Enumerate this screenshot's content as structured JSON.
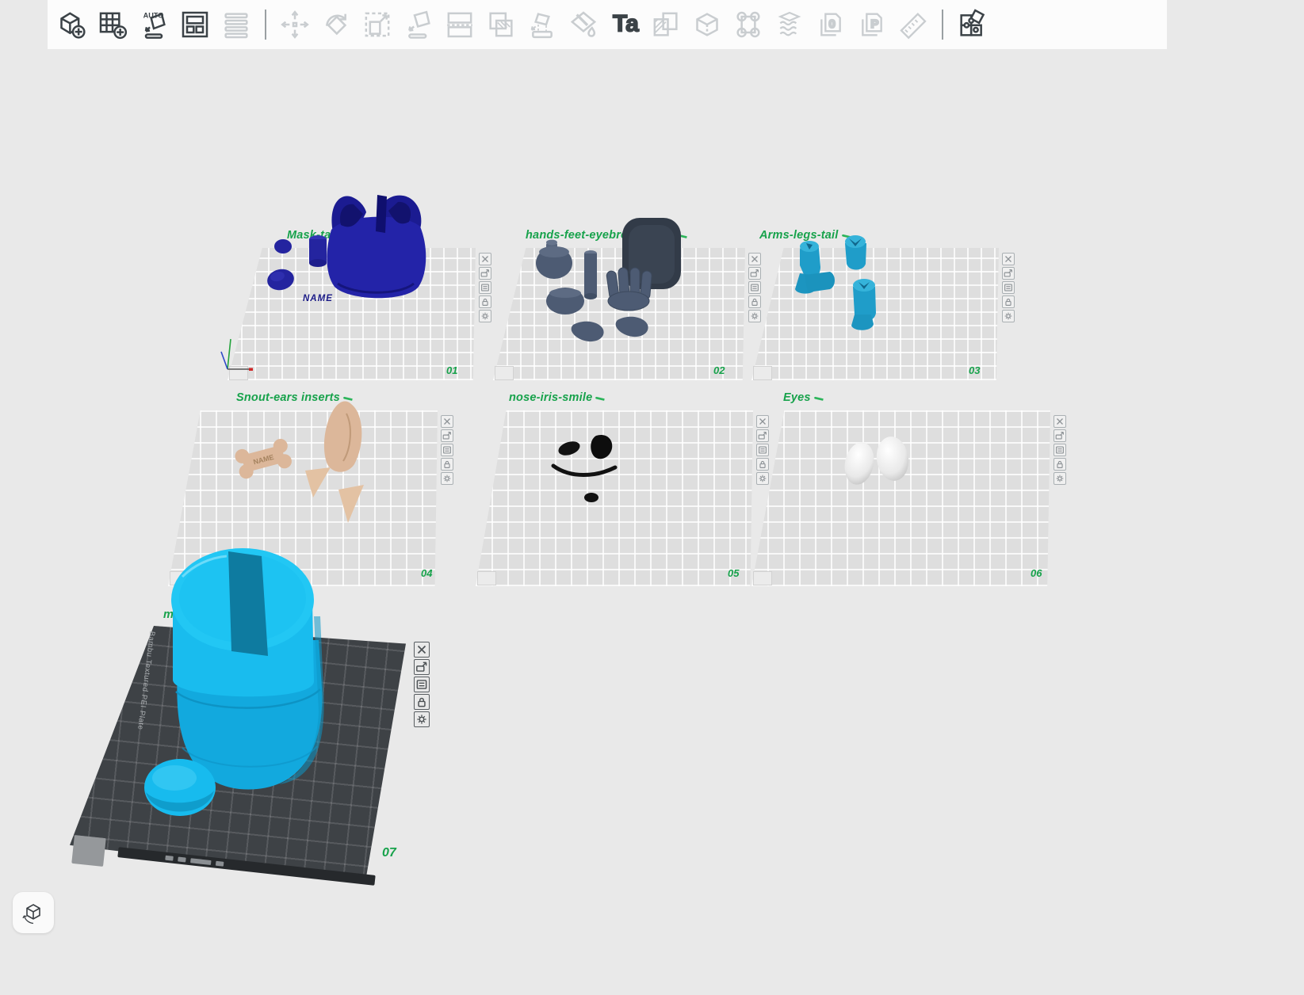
{
  "toolbar": {
    "auto_label": "AUTO",
    "text_tool_label": "Ta",
    "doc_zero_label": "0",
    "doc_p_label": "P",
    "tools": [
      {
        "name": "add-object",
        "enabled": true
      },
      {
        "name": "add-plate",
        "enabled": true
      },
      {
        "name": "auto-orient",
        "enabled": true
      },
      {
        "name": "arrange-all",
        "enabled": true
      },
      {
        "name": "variable-layer-height",
        "enabled": false
      },
      {
        "name": "move",
        "enabled": false
      },
      {
        "name": "rotate",
        "enabled": false
      },
      {
        "name": "scale",
        "enabled": false
      },
      {
        "name": "place-on-face",
        "enabled": false
      },
      {
        "name": "cut",
        "enabled": false
      },
      {
        "name": "mesh-boolean",
        "enabled": false
      },
      {
        "name": "support-painting",
        "enabled": false
      },
      {
        "name": "color-painting",
        "enabled": false
      },
      {
        "name": "text-shape",
        "enabled": true
      },
      {
        "name": "negative-part",
        "enabled": false
      },
      {
        "name": "cut-cube",
        "enabled": false
      },
      {
        "name": "seam-painting",
        "enabled": false
      },
      {
        "name": "fuzzy-skin",
        "enabled": false
      },
      {
        "name": "zero-document",
        "enabled": false
      },
      {
        "name": "p-document",
        "enabled": false
      },
      {
        "name": "measure",
        "enabled": false
      },
      {
        "name": "assembly-view",
        "enabled": true
      }
    ]
  },
  "plates": [
    {
      "number": "01",
      "name": "Mask-tail-"
    },
    {
      "number": "02",
      "name": "hands-feet-eyebrows-belly"
    },
    {
      "number": "03",
      "name": "Arms-legs-tail"
    },
    {
      "number": "04",
      "name": "Snout-ears inserts"
    },
    {
      "number": "05",
      "name": "nose-iris-smile"
    },
    {
      "number": "06",
      "name": "Eyes"
    },
    {
      "number": "07",
      "name": "m"
    }
  ],
  "plate_icons": [
    "delete-plate",
    "move-plate",
    "plate-settings",
    "lock-plate",
    "plate-gear"
  ],
  "plate_models": {
    "mask_name_text": "NAME",
    "bone_name_text": "NAME"
  },
  "plate7": {
    "edge_text": "Bambu Textured PEI Plate"
  },
  "colors": {
    "accent_green": "#17a24b",
    "mask_navy": "#2222a2",
    "slate_gray": "#4d5b73",
    "teal": "#1f9dc9",
    "tan": "#dcb79a",
    "cyan": "#18bdf0",
    "plate_dark": "#3e4246"
  }
}
